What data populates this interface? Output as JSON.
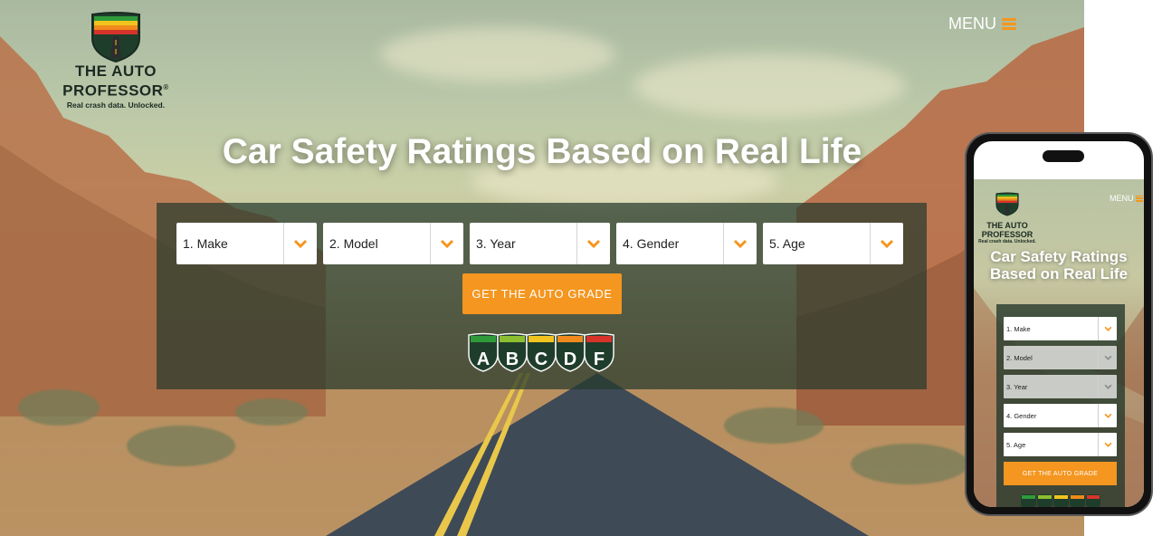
{
  "brand": {
    "name_line1": "THE AUTO",
    "name_line2": "PROFESSOR",
    "registered": "®",
    "tagline": "Real crash data. Unlocked."
  },
  "nav": {
    "menu_label": "MENU"
  },
  "hero": {
    "title": "Car Safety Ratings Based on Real Life"
  },
  "search": {
    "selects": [
      {
        "label": "1. Make"
      },
      {
        "label": "2. Model"
      },
      {
        "label": "3. Year"
      },
      {
        "label": "4. Gender"
      },
      {
        "label": "5. Age"
      }
    ],
    "cta_label": "GET THE AUTO GRADE"
  },
  "grades": [
    "A",
    "B",
    "C",
    "D",
    "F"
  ],
  "colors": {
    "accent": "#f4961f",
    "panel": "#263a2d",
    "grade_colors": [
      "#2f9a3a",
      "#8cbf2f",
      "#f2c41f",
      "#f08a1c",
      "#d6342a"
    ]
  },
  "mobile": {
    "menu_label": "MENU",
    "title_line1": "Car Safety Ratings",
    "title_line2": "Based on Real Life",
    "cta_label": "GET THE AUTO GRADE"
  }
}
